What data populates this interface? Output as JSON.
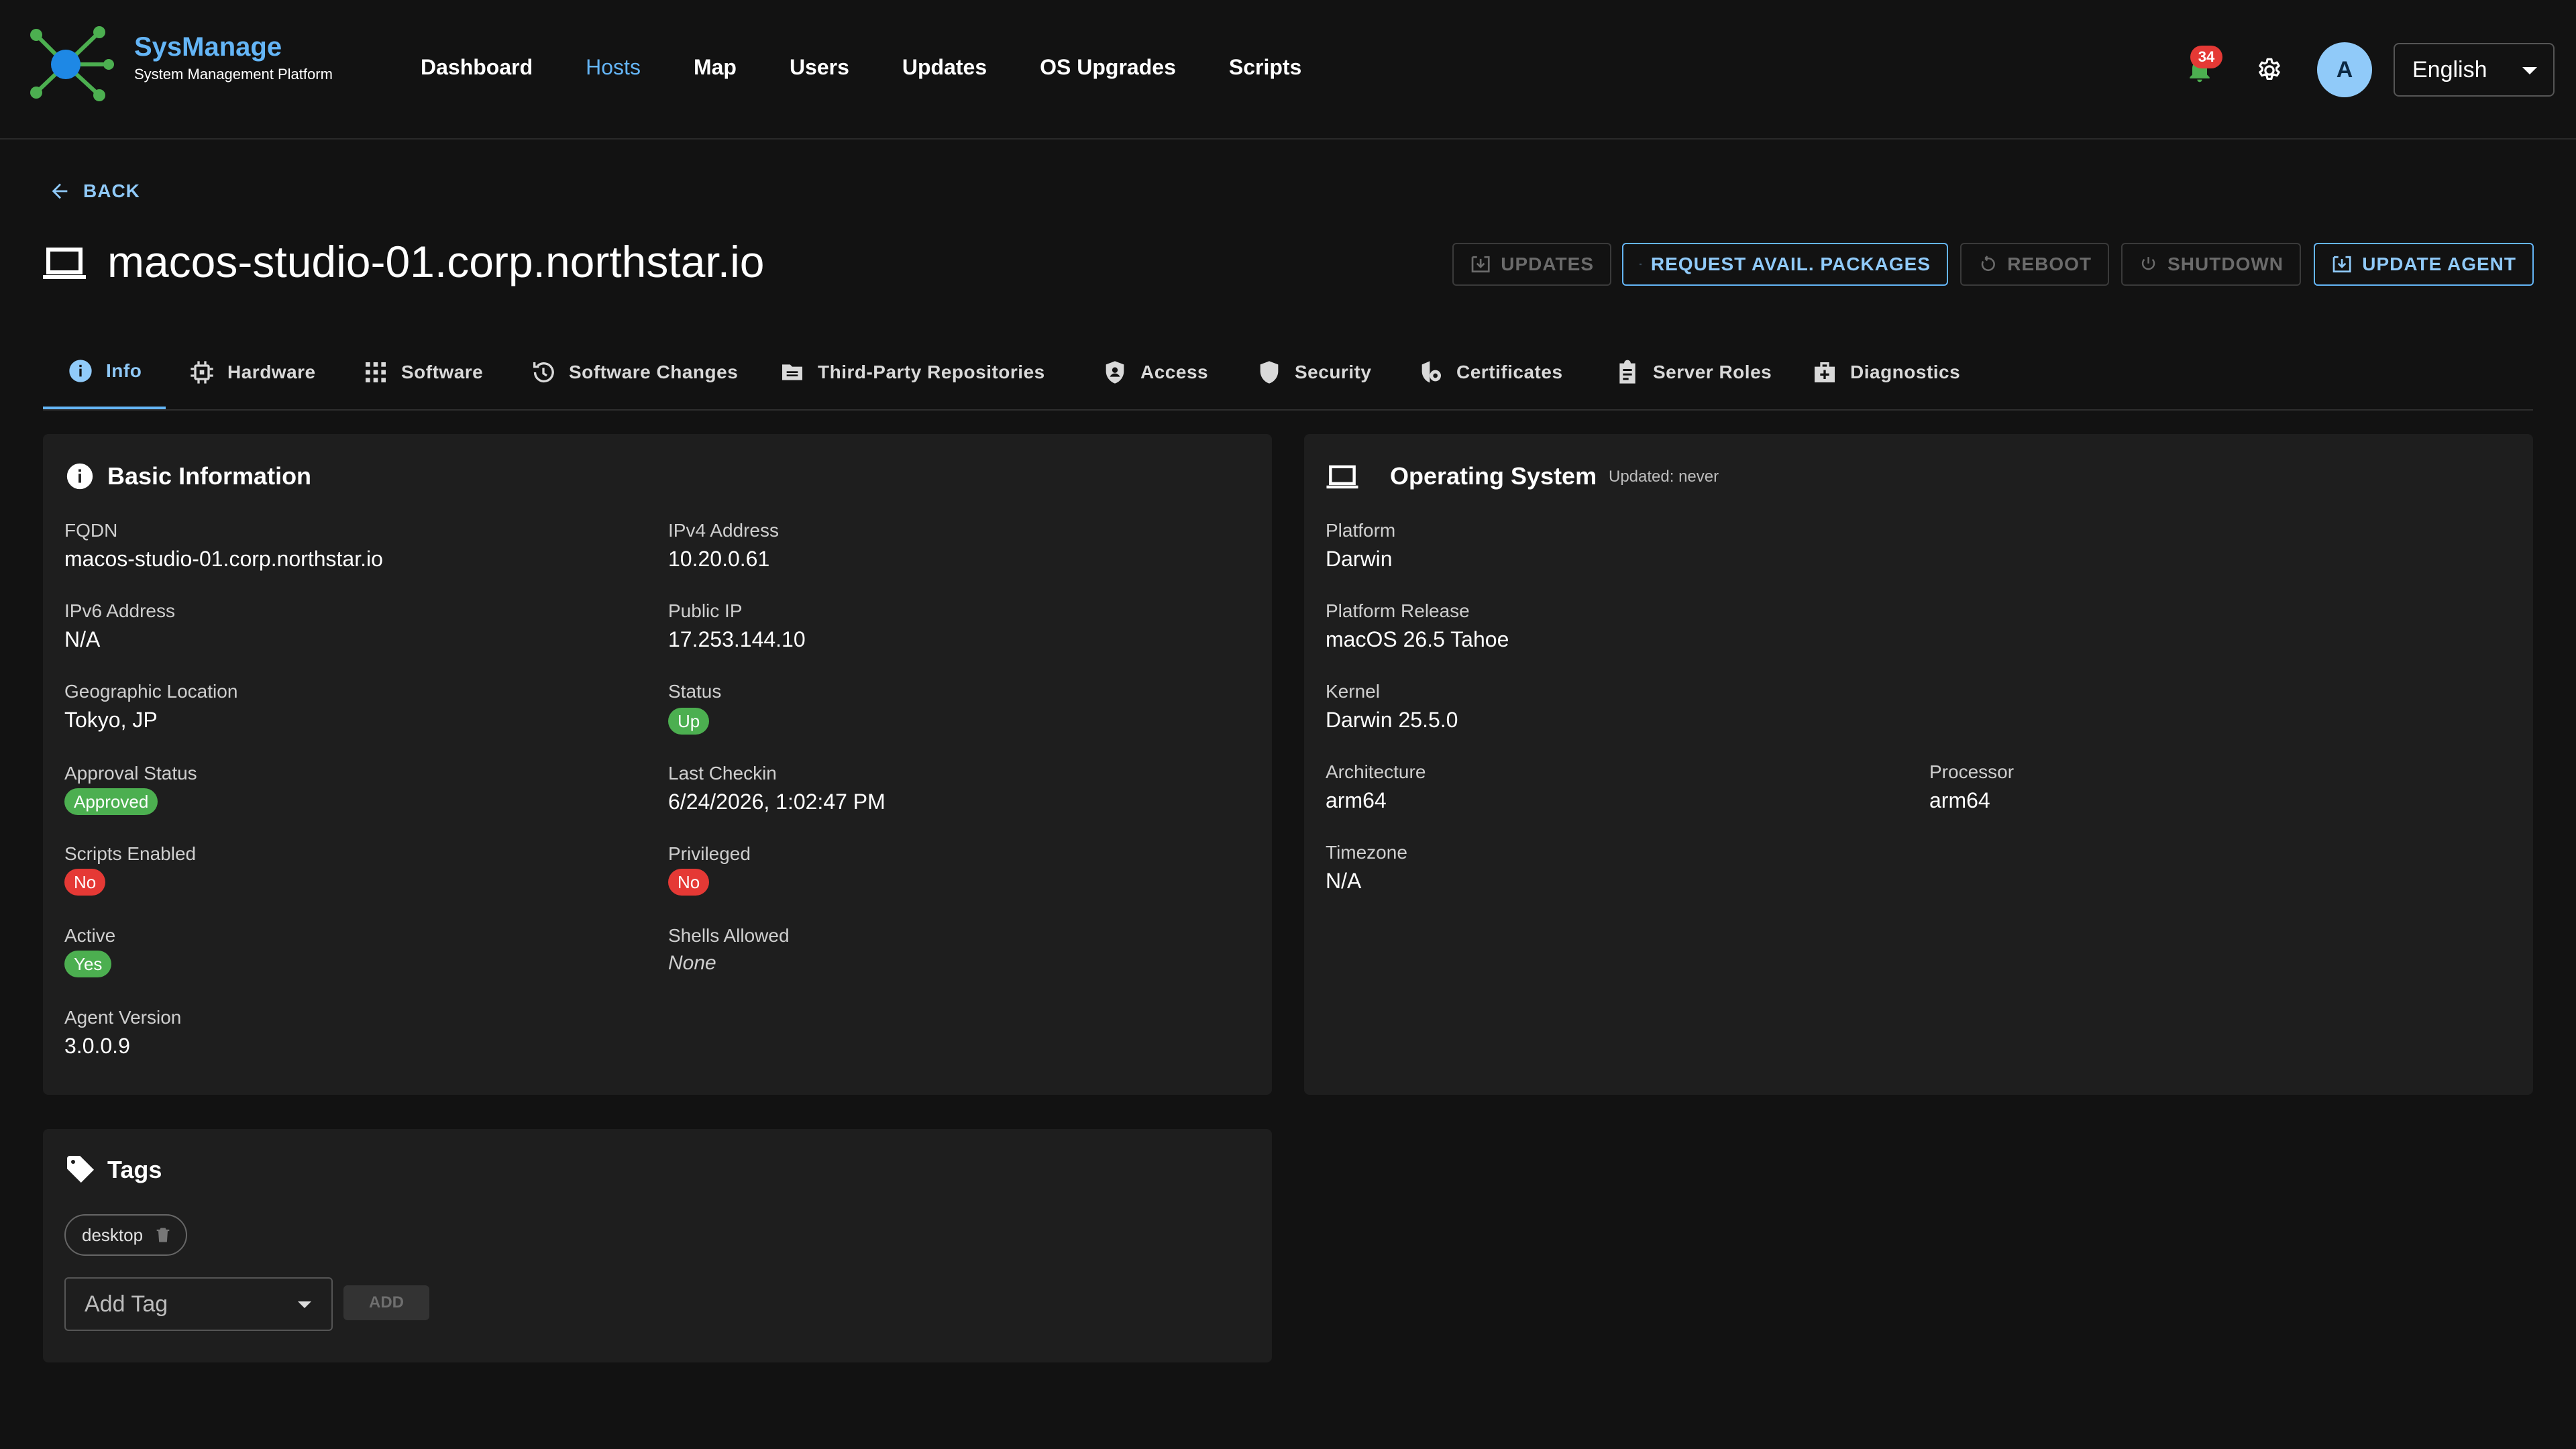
{
  "brand": {
    "name": "SysManage",
    "subtitle": "System Management Platform"
  },
  "nav": [
    {
      "label": "Dashboard",
      "active": false
    },
    {
      "label": "Hosts",
      "active": true
    },
    {
      "label": "Map",
      "active": false
    },
    {
      "label": "Users",
      "active": false
    },
    {
      "label": "Updates",
      "active": false
    },
    {
      "label": "OS Upgrades",
      "active": false
    },
    {
      "label": "Scripts",
      "active": false
    }
  ],
  "header": {
    "notification_count": "34",
    "avatar_letter": "A",
    "language": "English"
  },
  "back_label": "BACK",
  "host_title": "macos-studio-01.corp.northstar.io",
  "actions": {
    "updates": "UPDATES",
    "request_packages": "REQUEST AVAIL. PACKAGES",
    "reboot": "REBOOT",
    "shutdown": "SHUTDOWN",
    "update_agent": "UPDATE AGENT"
  },
  "tabs": [
    {
      "label": "Info",
      "icon": "info-icon"
    },
    {
      "label": "Hardware",
      "icon": "chip-icon"
    },
    {
      "label": "Software",
      "icon": "apps-grid-icon"
    },
    {
      "label": "Software Changes",
      "icon": "history-icon"
    },
    {
      "label": "Third-Party Repositories",
      "icon": "folder-icon"
    },
    {
      "label": "Access",
      "icon": "shield-person-icon"
    },
    {
      "label": "Security",
      "icon": "shield-icon"
    },
    {
      "label": "Certificates",
      "icon": "certificate-icon"
    },
    {
      "label": "Server Roles",
      "icon": "clipboard-icon"
    },
    {
      "label": "Diagnostics",
      "icon": "medkit-icon"
    }
  ],
  "basic_info": {
    "title": "Basic Information",
    "fqdn_label": "FQDN",
    "fqdn": "macos-studio-01.corp.northstar.io",
    "ipv4_label": "IPv4 Address",
    "ipv4": "10.20.0.61",
    "ipv6_label": "IPv6 Address",
    "ipv6": "N/A",
    "public_ip_label": "Public IP",
    "public_ip": "17.253.144.10",
    "geo_label": "Geographic Location",
    "geo": "Tokyo, JP",
    "status_label": "Status",
    "status": "Up",
    "approval_label": "Approval Status",
    "approval": "Approved",
    "last_checkin_label": "Last Checkin",
    "last_checkin": "6/24/2026, 1:02:47 PM",
    "scripts_label": "Scripts Enabled",
    "scripts": "No",
    "privileged_label": "Privileged",
    "privileged": "No",
    "active_label": "Active",
    "active": "Yes",
    "shells_label": "Shells Allowed",
    "shells": "None",
    "agent_label": "Agent Version",
    "agent": "3.0.0.9"
  },
  "os": {
    "title": "Operating System",
    "updated": "Updated: never",
    "platform_label": "Platform",
    "platform": "Darwin",
    "release_label": "Platform Release",
    "release": "macOS 26.5 Tahoe",
    "kernel_label": "Kernel",
    "kernel": "Darwin 25.5.0",
    "arch_label": "Architecture",
    "arch": "arm64",
    "processor_label": "Processor",
    "processor": "arm64",
    "tz_label": "Timezone",
    "tz": "N/A"
  },
  "tags": {
    "title": "Tags",
    "items": [
      "desktop"
    ],
    "add_placeholder": "Add Tag",
    "add_button": "ADD"
  }
}
